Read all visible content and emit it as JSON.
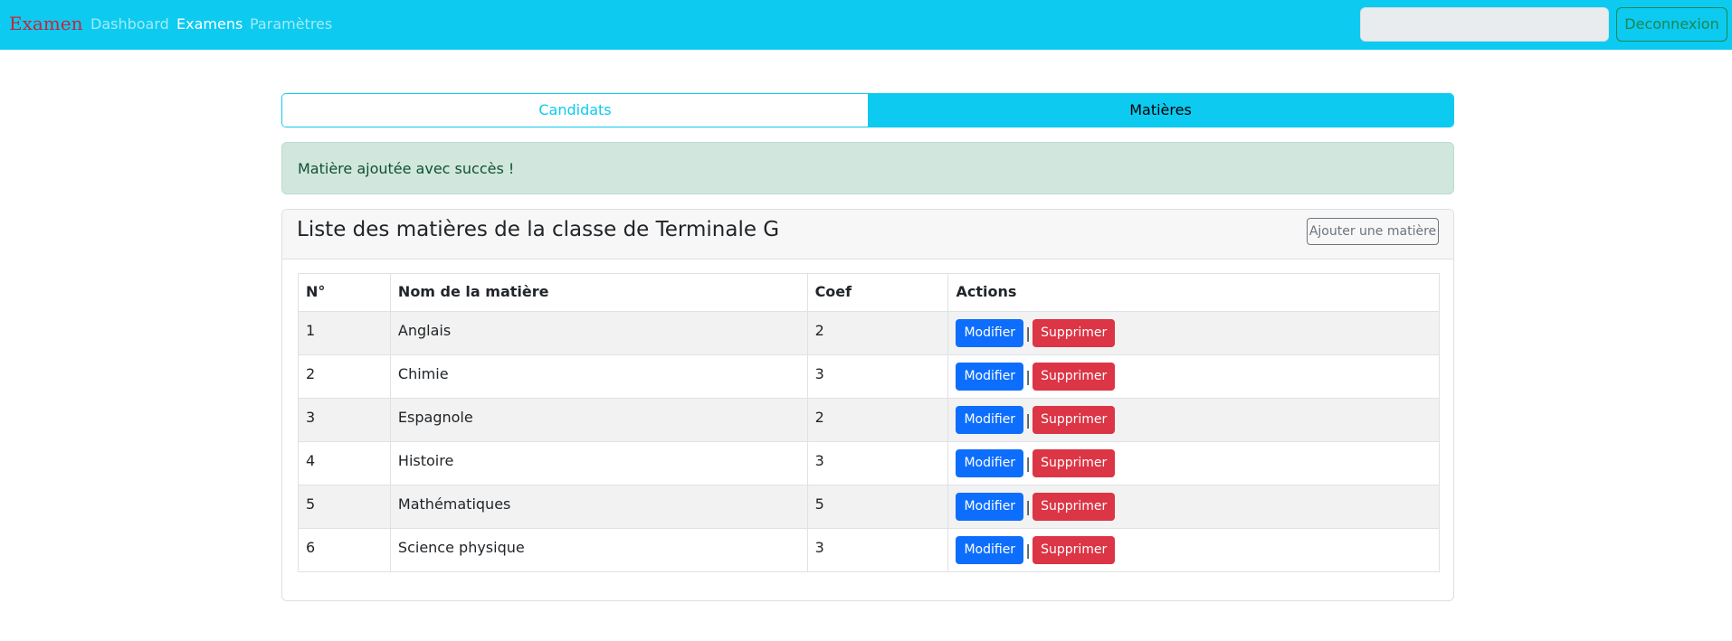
{
  "navbar": {
    "brand": "Examen",
    "links": [
      "Dashboard",
      "Examens",
      "Paramètres"
    ],
    "search_value": "",
    "logout_label": "Deconnexion"
  },
  "tabs": [
    "Candidats",
    "Matières"
  ],
  "alert": "Matière ajoutée avec succès !",
  "card": {
    "title": "Liste des matières de la classe de Terminale G",
    "add_label": "Ajouter une matière"
  },
  "table": {
    "headers": [
      "N°",
      "Nom de la matière",
      "Coef",
      "Actions"
    ],
    "rows": [
      {
        "num": "1",
        "name": "Anglais",
        "coef": "2"
      },
      {
        "num": "2",
        "name": "Chimie",
        "coef": "3"
      },
      {
        "num": "3",
        "name": "Espagnole",
        "coef": "2"
      },
      {
        "num": "4",
        "name": "Histoire",
        "coef": "3"
      },
      {
        "num": "5",
        "name": "Mathématiques",
        "coef": "5"
      },
      {
        "num": "6",
        "name": "Science physique",
        "coef": "3"
      }
    ],
    "edit_label": "Modifier",
    "separator": "|",
    "delete_label": "Supprimer"
  },
  "colors": {
    "navbar": "#0dcaf0",
    "brand": "#c72537",
    "alert_bg": "#d1e7dd",
    "edit_button": "#0d6efd",
    "delete_button": "#dc3545"
  }
}
